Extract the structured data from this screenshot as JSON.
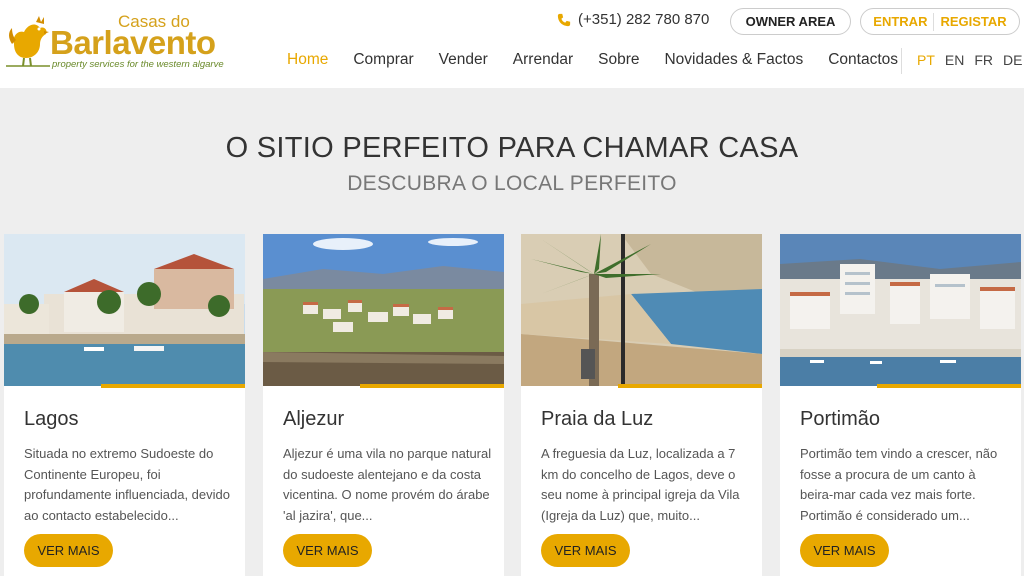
{
  "logo": {
    "line1": "Casas do",
    "line2": "Barlavento",
    "tagline": "property services for the western algarve"
  },
  "header": {
    "phone": "(+351) 282 780 870",
    "owner_area": "OWNER AREA",
    "login": "ENTRAR",
    "register": "REGISTAR"
  },
  "nav": {
    "items": [
      {
        "label": "Home"
      },
      {
        "label": "Comprar"
      },
      {
        "label": "Vender"
      },
      {
        "label": "Arrendar"
      },
      {
        "label": "Sobre"
      },
      {
        "label": "Novidades & Factos"
      },
      {
        "label": "Contactos"
      }
    ],
    "active_index": 0
  },
  "languages": {
    "items": [
      {
        "label": "PT"
      },
      {
        "label": "EN"
      },
      {
        "label": "FR"
      },
      {
        "label": "DE"
      }
    ],
    "active_index": 0
  },
  "hero": {
    "title": "O SITIO PERFEITO PARA CHAMAR CASA",
    "subtitle": "DESCUBRA O LOCAL PERFEITO"
  },
  "cards": [
    {
      "title": "Lagos",
      "text": "Situada no extremo Sudoeste do Continente Europeu, foi profundamente influenciada, devido ao contacto estabelecido...",
      "button": "VER MAIS"
    },
    {
      "title": "Aljezur",
      "text": "Aljezur é uma vila no parque natural do sudoeste alentejano e da costa vicentina. O nome provém do árabe 'al jazira', que...",
      "button": "VER MAIS"
    },
    {
      "title": "Praia da Luz",
      "text": "A freguesia da Luz, localizada a 7 km do concelho de Lagos, deve o seu nome à principal igreja da Vila (Igreja da Luz) que, muito...",
      "button": "VER MAIS"
    },
    {
      "title": "Portimão",
      "text": "Portimão tem vindo a crescer, não fosse a procura de um canto à beira-mar cada vez mais forte. Portimão é considerado um...",
      "button": "VER MAIS"
    }
  ],
  "colors": {
    "accent": "#e8a800",
    "background": "#eeeeee"
  }
}
